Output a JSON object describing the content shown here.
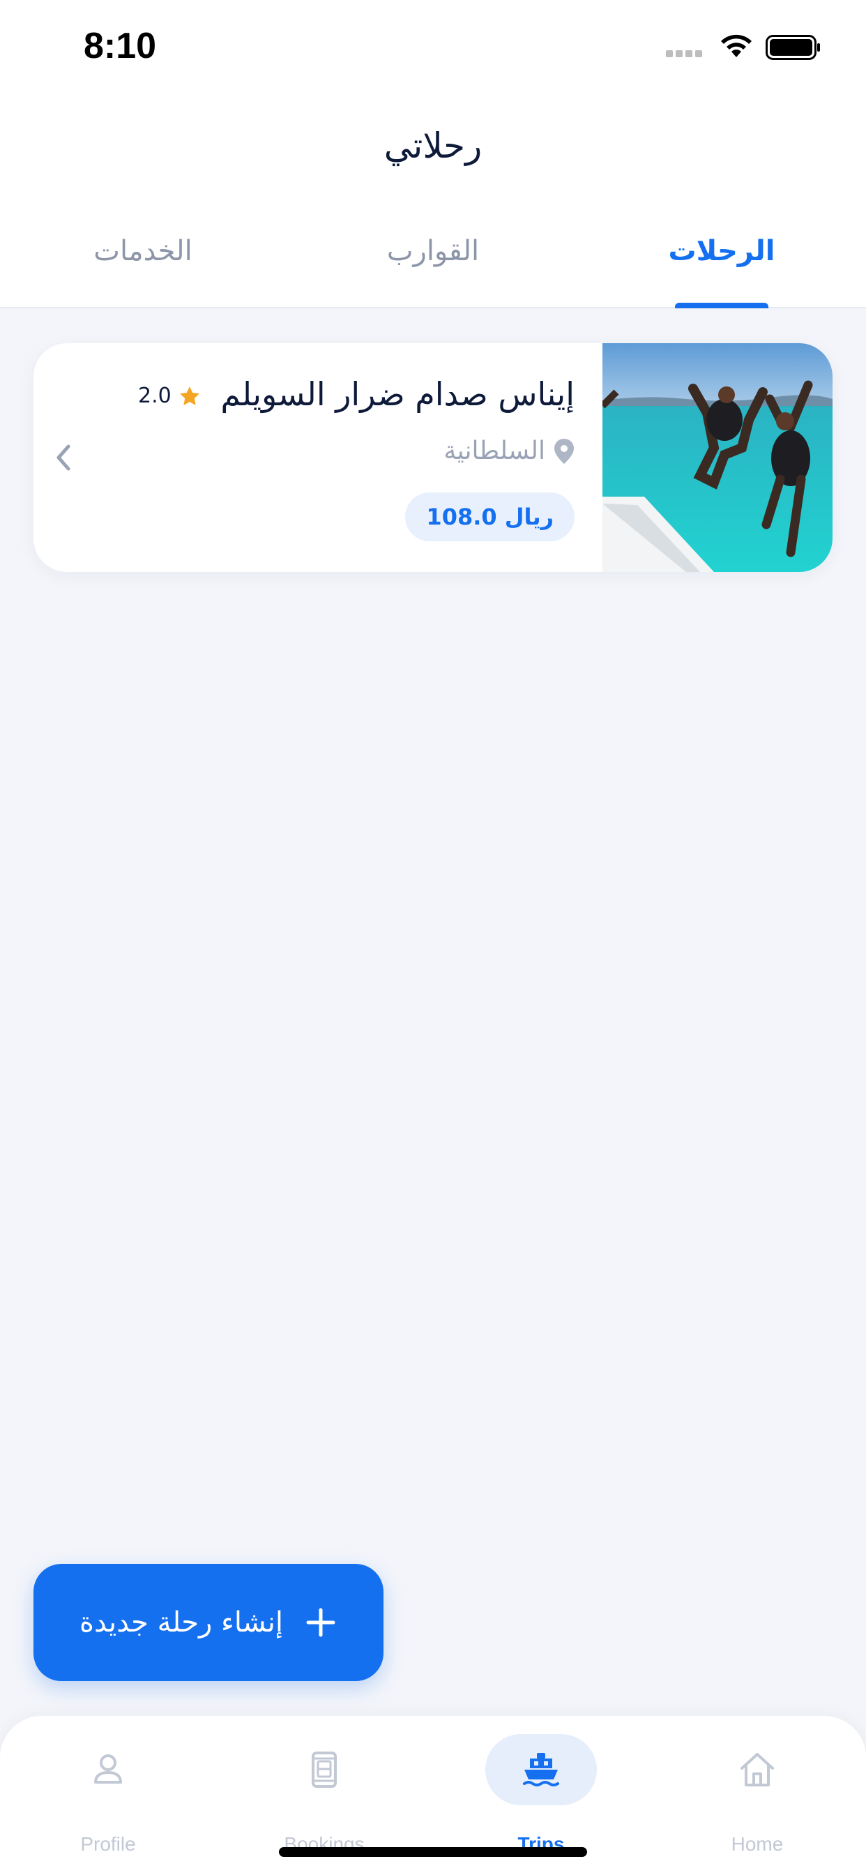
{
  "status_bar": {
    "time": "8:10"
  },
  "header": {
    "title": "رحلاتي",
    "tabs": [
      {
        "label": "الرحلات",
        "active": true
      },
      {
        "label": "القوارب",
        "active": false
      },
      {
        "label": "الخدمات",
        "active": false
      }
    ]
  },
  "trips": [
    {
      "name": "إيناس صدام ضرار السويلم",
      "rating": "2.0",
      "location": "السلطانية",
      "price": "108.0 ريال"
    }
  ],
  "fab": {
    "label": "إنشاء رحلة جديدة"
  },
  "bottom_nav": [
    {
      "label": "Profile",
      "icon": "person-icon",
      "active": false
    },
    {
      "label": "Bookings",
      "icon": "booking-icon",
      "active": false
    },
    {
      "label": "Trips",
      "icon": "boat-icon",
      "active": true
    },
    {
      "label": "Home",
      "icon": "home-icon",
      "active": false
    }
  ],
  "colors": {
    "accent": "#1570EF",
    "background": "#F3F5FA",
    "star": "#F5A524",
    "muted": "#9AA3B5"
  }
}
